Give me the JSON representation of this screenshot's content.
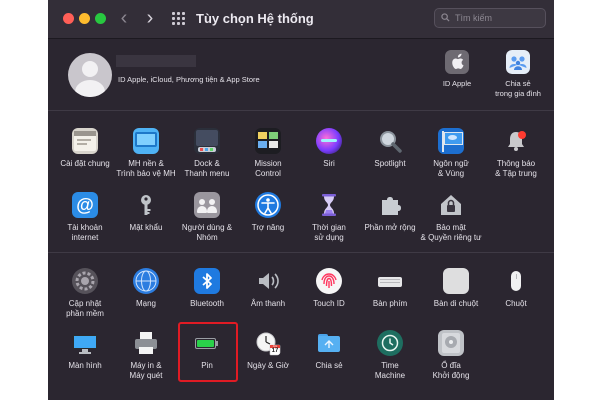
{
  "window": {
    "title": "Tùy chọn Hệ thống"
  },
  "search": {
    "placeholder": "Tìm kiếm"
  },
  "account": {
    "subtitle": "ID Apple, iCloud, Phương tiện & App Store",
    "apple_id_label": "ID Apple",
    "family_label_1": "Chia sẻ",
    "family_label_2": "trong gia đình"
  },
  "row1": [
    {
      "l1": "Cài đặt chung",
      "l2": ""
    },
    {
      "l1": "MH nền &",
      "l2": "Trình bảo vệ MH"
    },
    {
      "l1": "Dock &",
      "l2": "Thanh menu"
    },
    {
      "l1": "Mission",
      "l2": "Control"
    },
    {
      "l1": "Siri",
      "l2": ""
    },
    {
      "l1": "Spotlight",
      "l2": ""
    },
    {
      "l1": "Ngôn ngữ",
      "l2": "& Vùng"
    },
    {
      "l1": "Thông báo",
      "l2": "& Tập trung"
    }
  ],
  "row2": [
    {
      "l1": "Tài khoản",
      "l2": "internet"
    },
    {
      "l1": "Mật khẩu",
      "l2": ""
    },
    {
      "l1": "Người dùng &",
      "l2": "Nhóm"
    },
    {
      "l1": "Trợ năng",
      "l2": ""
    },
    {
      "l1": "Thời gian",
      "l2": "sử dụng"
    },
    {
      "l1": "Phần mở rộng",
      "l2": ""
    },
    {
      "l1": "Bảo mật",
      "l2": "& Quyền riêng tư"
    }
  ],
  "row3": [
    {
      "l1": "Cập nhật",
      "l2": "phần mềm"
    },
    {
      "l1": "Mạng",
      "l2": ""
    },
    {
      "l1": "Bluetooth",
      "l2": ""
    },
    {
      "l1": "Âm thanh",
      "l2": ""
    },
    {
      "l1": "Touch ID",
      "l2": ""
    },
    {
      "l1": "Bàn phím",
      "l2": ""
    },
    {
      "l1": "Bàn di chuột",
      "l2": ""
    },
    {
      "l1": "Chuột",
      "l2": ""
    }
  ],
  "row4": [
    {
      "l1": "Màn hình",
      "l2": ""
    },
    {
      "l1": "Máy in &",
      "l2": "Máy quét"
    },
    {
      "l1": "Pin",
      "l2": ""
    },
    {
      "l1": "Ngày & Giờ",
      "l2": ""
    },
    {
      "l1": "Chia sẻ",
      "l2": ""
    },
    {
      "l1": "Time",
      "l2": "Machine"
    },
    {
      "l1": "Ổ đĩa",
      "l2": "Khởi động"
    }
  ],
  "calendar": {
    "month": "JUL",
    "day": "17"
  },
  "highlight_color": "#e01b24"
}
